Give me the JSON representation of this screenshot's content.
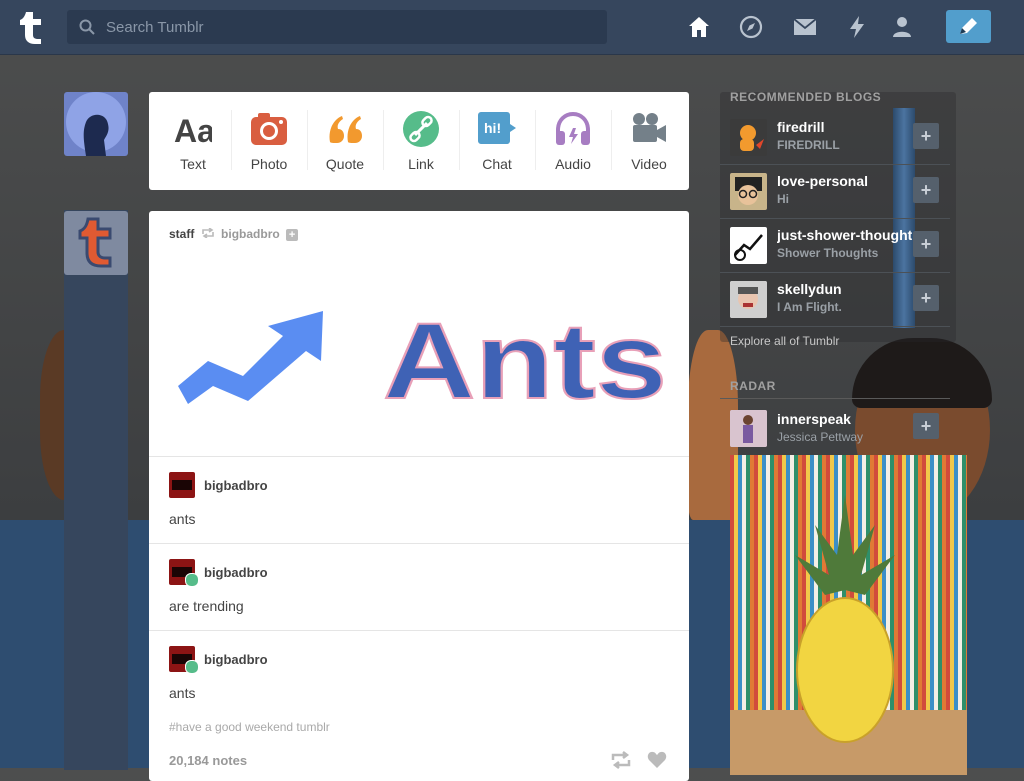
{
  "header": {
    "search_placeholder": "Search Tumblr",
    "nav_icons": [
      "home-icon",
      "explore-icon",
      "mail-icon",
      "activity-icon",
      "account-icon"
    ],
    "compose_icon": "pencil-icon",
    "accent": "#529ecc",
    "background": "#36465d"
  },
  "composer": {
    "types": [
      {
        "label": "Text",
        "icon": "text-icon",
        "color": "#444444"
      },
      {
        "label": "Photo",
        "icon": "camera-icon",
        "color": "#d95e40"
      },
      {
        "label": "Quote",
        "icon": "quote-icon",
        "color": "#f2992e"
      },
      {
        "label": "Link",
        "icon": "link-icon",
        "color": "#56bc8a"
      },
      {
        "label": "Chat",
        "icon": "chat-icon",
        "color": "#529ecc",
        "badge": "hi!"
      },
      {
        "label": "Audio",
        "icon": "headphones-icon",
        "color": "#a77dc2"
      },
      {
        "label": "Video",
        "icon": "video-camera-icon",
        "color": "#748089"
      }
    ]
  },
  "post": {
    "author": "staff",
    "reblogged_from": "bigbadbro",
    "image_text": "Ants",
    "replies": [
      {
        "name": "bigbadbro",
        "text": "ants"
      },
      {
        "name": "bigbadbro",
        "text": "are trending"
      },
      {
        "name": "bigbadbro",
        "text": "ants"
      }
    ],
    "tag": "#have a good weekend tumblr",
    "notes": "20,184 notes"
  },
  "sidebar": {
    "recommended_title": "RECOMMENDED BLOGS",
    "recommended": [
      {
        "name": "firedrill",
        "subtitle": "FIREDRILL"
      },
      {
        "name": "love-personal",
        "subtitle": "Hi"
      },
      {
        "name": "just-shower-thoughts",
        "subtitle": "Shower Thoughts"
      },
      {
        "name": "skellydun",
        "subtitle": "I Am Flight."
      }
    ],
    "explore_link": "Explore all of Tumblr",
    "radar_title": "RADAR",
    "radar": {
      "name": "innerspeak",
      "subtitle": "Jessica Pettway"
    }
  }
}
